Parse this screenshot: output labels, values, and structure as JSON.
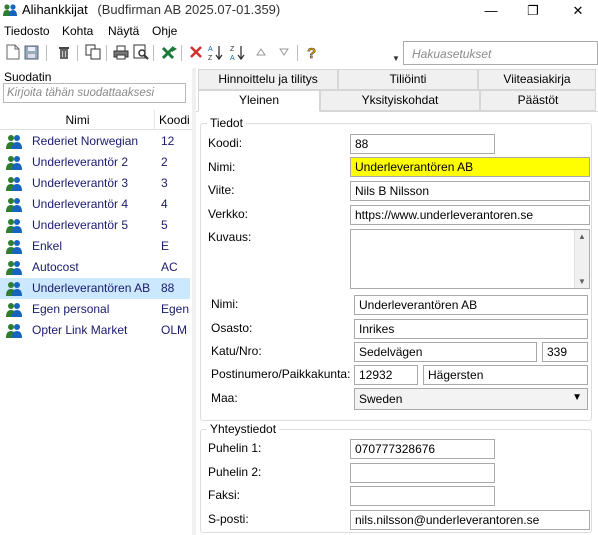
{
  "window": {
    "title": "Alihankkijat",
    "subtitle": "(Budfirman AB 2025.07-01.359)",
    "minimize_glyph": "—",
    "maximize_glyph": "❐",
    "close_glyph": "✕"
  },
  "menu": [
    "Tiedosto",
    "Kohta",
    "Näytä",
    "Ohje"
  ],
  "toolbar": {
    "icons": [
      "new-document-icon",
      "save-icon",
      "delete-icon",
      "copy-icon",
      "print-icon",
      "print-preview-icon",
      "excel-export-icon",
      "cancel-icon",
      "sort-ascending-icon",
      "sort-descending-icon",
      "move-up-icon",
      "move-down-icon",
      "help-icon"
    ],
    "sort_asc": "A↓Z",
    "sort_desc": "Z↓A",
    "help": "?",
    "search_placeholder": "Hakuasetukset"
  },
  "left": {
    "filter_label": "Suodatin",
    "filter_placeholder": "Kirjoita tähän suodattaaksesi",
    "col_name": "Nimi",
    "col_code": "Koodi",
    "rows": [
      {
        "name": "Rederiet Norwegian",
        "code": "12"
      },
      {
        "name": "Underleverantör 2",
        "code": "2"
      },
      {
        "name": "Underleverantör 3",
        "code": "3"
      },
      {
        "name": "Underleverantör 4",
        "code": "4"
      },
      {
        "name": "Underleverantör 5",
        "code": "5"
      },
      {
        "name": "Enkel",
        "code": "E"
      },
      {
        "name": "Autocost",
        "code": "AC"
      },
      {
        "name": "Underleverantören AB",
        "code": "88",
        "selected": true
      },
      {
        "name": "Egen personal",
        "code": "Egen"
      },
      {
        "name": "Opter Link Market",
        "code": "OLM"
      }
    ]
  },
  "tabs": {
    "row1": [
      "Hinnoittelu ja tilitys",
      "Tiliöinti",
      "Viiteasiakirja"
    ],
    "row2": [
      "Yleinen",
      "Yksityiskohdat",
      "Päästöt"
    ],
    "active": "Yleinen"
  },
  "tiedot": {
    "group_title": "Tiedot",
    "koodi_label": "Koodi:",
    "koodi_value": "88",
    "nimi_label": "Nimi:",
    "nimi_value": "Underleverantören AB",
    "viite_label": "Viite:",
    "viite_value": "Nils B Nilsson",
    "verkko_label": "Verkko:",
    "verkko_value": "https://www.underleverantoren.se",
    "kuvaus_label": "Kuvaus:",
    "kuvaus_value": "",
    "address_nimi_label": "Nimi:",
    "address_nimi_value": "Underleverantören AB",
    "osasto_label": "Osasto:",
    "osasto_value": "Inrikes",
    "katu_label": "Katu/Nro:",
    "katu_value": "Sedelvägen",
    "nro_value": "339",
    "postinumero_label": "Postinumero/Paikkakunta:",
    "postinumero_value": "12932",
    "paikkakunta_value": "Hägersten",
    "maa_label": "Maa:",
    "maa_value": "Sweden"
  },
  "yhteystiedot": {
    "group_title": "Yhteystiedot",
    "puhelin1_label": "Puhelin 1:",
    "puhelin1_value": "070777328676",
    "puhelin2_label": "Puhelin 2:",
    "puhelin2_value": "",
    "faksi_label": "Faksi:",
    "faksi_value": "",
    "sposti_label": "S-posti:",
    "sposti_value": "nils.nilsson@underleverantoren.se"
  },
  "colors": {
    "selected_row": "#cce8ff",
    "highlight_field": "#ffff00",
    "row_text": "#1a1a6e"
  }
}
